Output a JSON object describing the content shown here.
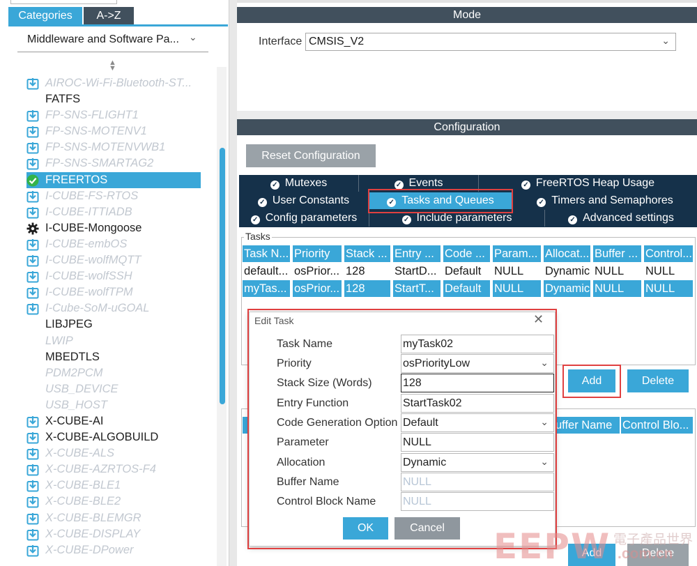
{
  "sidebar": {
    "tabs": [
      "Categories",
      "A->Z"
    ],
    "category": "Middleware and Software Pa...",
    "items": [
      {
        "label": "AIROC-Wi-Fi-Bluetooth-ST...",
        "state": "dis",
        "icon": "download-icon"
      },
      {
        "label": "FATFS",
        "state": "on",
        "icon": ""
      },
      {
        "label": "FP-SNS-FLIGHT1",
        "state": "dis",
        "icon": "download-icon"
      },
      {
        "label": "FP-SNS-MOTENV1",
        "state": "dis",
        "icon": "download-icon"
      },
      {
        "label": "FP-SNS-MOTENVWB1",
        "state": "dis",
        "icon": "download-icon"
      },
      {
        "label": "FP-SNS-SMARTAG2",
        "state": "dis",
        "icon": "download-icon"
      },
      {
        "label": "FREERTOS",
        "state": "sel",
        "icon": "check-circle-icon"
      },
      {
        "label": "I-CUBE-FS-RTOS",
        "state": "dis",
        "icon": "download-icon"
      },
      {
        "label": "I-CUBE-ITTIADB",
        "state": "dis",
        "icon": "download-icon"
      },
      {
        "label": "I-CUBE-Mongoose",
        "state": "on",
        "icon": "gear-icon"
      },
      {
        "label": "I-CUBE-embOS",
        "state": "dis",
        "icon": "download-icon"
      },
      {
        "label": "I-CUBE-wolfMQTT",
        "state": "dis",
        "icon": "download-icon"
      },
      {
        "label": "I-CUBE-wolfSSH",
        "state": "dis",
        "icon": "download-icon"
      },
      {
        "label": "I-CUBE-wolfTPM",
        "state": "dis",
        "icon": "download-icon"
      },
      {
        "label": "I-Cube-SoM-uGOAL",
        "state": "dis",
        "icon": "download-icon"
      },
      {
        "label": "LIBJPEG",
        "state": "on",
        "icon": ""
      },
      {
        "label": "LWIP",
        "state": "dis",
        "icon": ""
      },
      {
        "label": "MBEDTLS",
        "state": "on",
        "icon": ""
      },
      {
        "label": "PDM2PCM",
        "state": "dis",
        "icon": ""
      },
      {
        "label": "USB_DEVICE",
        "state": "dis",
        "icon": ""
      },
      {
        "label": "USB_HOST",
        "state": "dis",
        "icon": ""
      },
      {
        "label": "X-CUBE-AI",
        "state": "on",
        "icon": "download-icon"
      },
      {
        "label": "X-CUBE-ALGOBUILD",
        "state": "on",
        "icon": "download-icon"
      },
      {
        "label": "X-CUBE-ALS",
        "state": "dis",
        "icon": "download-icon"
      },
      {
        "label": "X-CUBE-AZRTOS-F4",
        "state": "dis",
        "icon": "download-icon"
      },
      {
        "label": "X-CUBE-BLE1",
        "state": "dis",
        "icon": "download-icon"
      },
      {
        "label": "X-CUBE-BLE2",
        "state": "dis",
        "icon": "download-icon"
      },
      {
        "label": "X-CUBE-BLEMGR",
        "state": "dis",
        "icon": "download-icon"
      },
      {
        "label": "X-CUBE-DISPLAY",
        "state": "dis",
        "icon": "download-icon"
      },
      {
        "label": "X-CUBE-DPower",
        "state": "dis",
        "icon": "download-icon"
      }
    ]
  },
  "mode": {
    "header": "Mode",
    "interface_label": "Interface",
    "interface_value": "CMSIS_V2"
  },
  "configuration": {
    "header": "Configuration",
    "reset_label": "Reset Configuration",
    "tabs_row1": [
      "Mutexes",
      "Events",
      "FreeRTOS Heap Usage"
    ],
    "tabs_row2": [
      "User Constants",
      "Tasks and Queues",
      "Timers and Semaphores"
    ],
    "tabs_row3": [
      "Config parameters",
      "Include parameters",
      "Advanced settings"
    ],
    "active_tab": "Tasks and Queues",
    "tasks_legend": "Tasks",
    "columns": [
      "Task N...",
      "Priority",
      "Stack ...",
      "Entry ...",
      "Code ...",
      "Param...",
      "Allocat...",
      "Buffer ...",
      "Control..."
    ],
    "rows": [
      [
        "default...",
        "osPrior...",
        "128",
        "StartD...",
        "Default",
        "NULL",
        "Dynamic",
        "NULL",
        "NULL"
      ],
      [
        "myTas...",
        "osPrior...",
        "128",
        "StartT...",
        "Default",
        "NULL",
        "Dynamic",
        "NULL",
        "NULL"
      ]
    ],
    "add_label": "Add",
    "delete_label": "Delete",
    "queue_legend": "Q",
    "queue_columns_visible": [
      "uffer Name",
      "Control Blo..."
    ]
  },
  "dialog": {
    "title": "Edit Task",
    "fields": [
      {
        "label": "Task Name",
        "value": "myTask02",
        "kind": "text"
      },
      {
        "label": "Priority",
        "value": "osPriorityLow",
        "kind": "select"
      },
      {
        "label": "Stack Size (Words)",
        "value": "128",
        "kind": "focus"
      },
      {
        "label": "Entry Function",
        "value": "StartTask02",
        "kind": "text"
      },
      {
        "label": "Code Generation Option",
        "value": "Default",
        "kind": "select"
      },
      {
        "label": "Parameter",
        "value": "NULL",
        "kind": "text"
      },
      {
        "label": "Allocation",
        "value": "Dynamic",
        "kind": "select"
      },
      {
        "label": "Buffer Name",
        "value": "NULL",
        "kind": "placeholder"
      },
      {
        "label": "Control Block Name",
        "value": "NULL",
        "kind": "placeholder"
      }
    ],
    "ok_label": "OK",
    "cancel_label": "Cancel"
  },
  "watermark": {
    "big": "EEPW",
    "cn": "電子產品世界",
    "url": ".com.cn"
  },
  "colors": {
    "accent": "#3aa7d8",
    "header_dark": "#41505d",
    "tabs_navy": "#15314a",
    "highlight_red": "#e04040",
    "disabled_text": "#c2c8d0"
  }
}
